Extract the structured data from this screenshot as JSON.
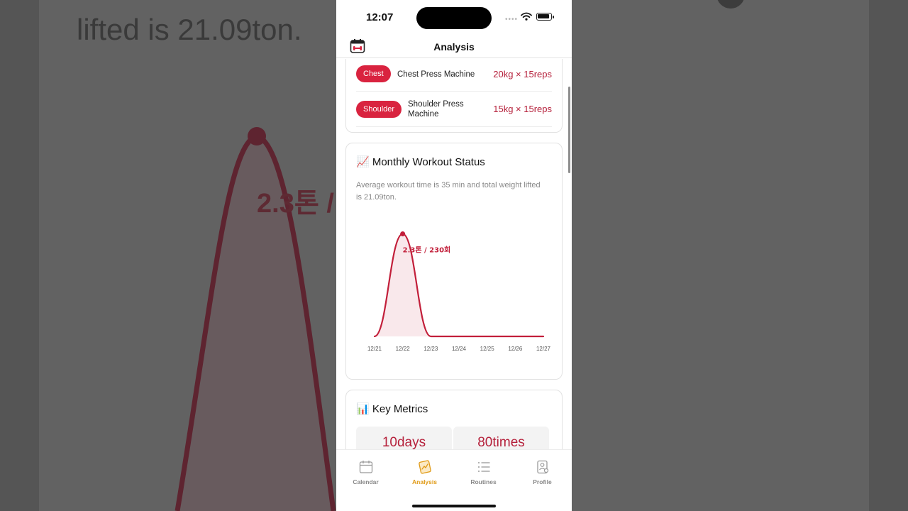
{
  "status": {
    "time": "12:07"
  },
  "header": {
    "title": "Analysis",
    "icon": "calendar-dumbbell-icon"
  },
  "exercises": [
    {
      "part": "Chest",
      "name": "Chest Press Machine",
      "value": "20kg × 15reps"
    },
    {
      "part": "Shoulder",
      "name": "Shoulder Press Machine",
      "value": "15kg × 15reps"
    }
  ],
  "monthly": {
    "title": "📈 Monthly Workout Status",
    "subtitle": "Average workout time is 35 min and total weight lifted is 21.09ton."
  },
  "chart_data": {
    "type": "area",
    "x": [
      "12/21",
      "12/22",
      "12/23",
      "12/24",
      "12/25",
      "12/26",
      "12/27"
    ],
    "series": [
      {
        "values": [
          0,
          2.3,
          0,
          0,
          0,
          0,
          0
        ]
      }
    ],
    "peak_label": "2.3톤 / 230회",
    "ylim": [
      0,
      2.5
    ],
    "grid": false,
    "color": "#c21f3a"
  },
  "metrics": {
    "title": "📊 Key Metrics",
    "items": [
      {
        "value": "10days"
      },
      {
        "value": "80times"
      }
    ]
  },
  "background": {
    "text": "lifted is 21.09ton.",
    "label": "2.3톤 /"
  },
  "tabs": [
    {
      "label": "Calendar",
      "icon": "calendar-icon",
      "active": false
    },
    {
      "label": "Analysis",
      "icon": "analysis-icon",
      "active": true
    },
    {
      "label": "Routines",
      "icon": "list-icon",
      "active": false
    },
    {
      "label": "Profile",
      "icon": "profile-icon",
      "active": false
    }
  ],
  "colors": {
    "accent": "#d9233f",
    "value": "#b51f3a",
    "tab_active": "#e09a16"
  }
}
